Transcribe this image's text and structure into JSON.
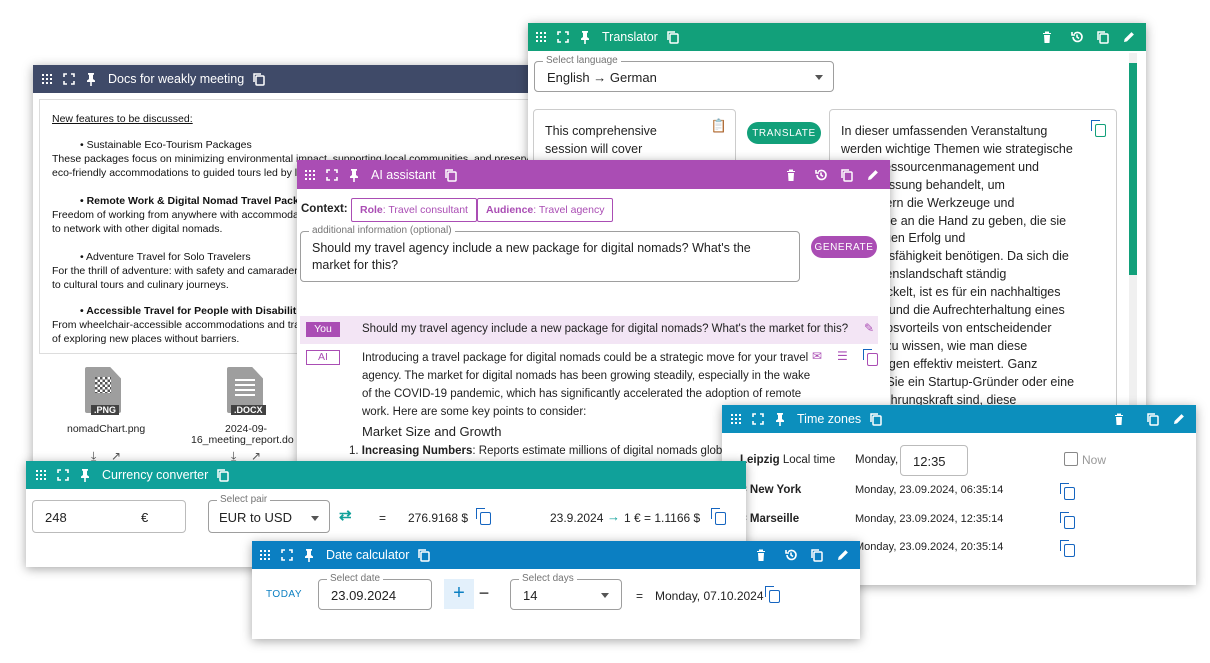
{
  "docs": {
    "title": "Docs for weakly meeting",
    "heading": "New features to be discussed:",
    "features": [
      {
        "title": "• Sustainable Eco-Tourism Packages",
        "desc1": "These packages focus on minimizing environmental impact, supporting local communities, and preserving natu",
        "desc2": "eco-friendly accommodations to guided tours led by loca",
        "bold": false
      },
      {
        "title": "• Remote Work & Digital Nomad Travel Package",
        "desc1": "Freedom of working from anywhere with accommodation",
        "desc2": "to network with other digital nomads.",
        "bold": true
      },
      {
        "title": "• Adventure Travel for Solo Travelers",
        "desc1": "For the thrill of adventure: with safety and camaraderie i",
        "desc2": "to cultural tours and culinary journeys.",
        "bold": false
      },
      {
        "title": "• Accessible Travel for People with Disabilities",
        "desc1": "From wheelchair-accessible accommodations and transp",
        "desc2": "of exploring new places without barriers.",
        "bold": true
      }
    ],
    "files": [
      {
        "badge": ".PNG",
        "name": "nomadChart.png",
        "name2": ""
      },
      {
        "badge": ".DOCX",
        "name": "2024-09-",
        "name2": "16_meeting_report.do"
      }
    ]
  },
  "translator": {
    "title": "Translator",
    "lang_label": "Select language",
    "lang_value": "English → German",
    "source": [
      "This comprehensive",
      "session will cover"
    ],
    "translate_label": "TRANSLATE",
    "target": [
      "In dieser umfassenden Veranstaltung",
      "werden wichtige Themen wie strategische",
      "Ressourcenmanagement und",
      "passung behandelt, um",
      "mern die Werkzeuge und",
      "isse an die Hand zu geben, die sie",
      "itigen Erfolg und",
      "ndsfähigkeit benötigen. Da sich die",
      "menslandschaft ständig",
      "wickelt, ist es für ein nachhaltiges",
      "m und die Aufrechterhaltung eines",
      "erbsvorteils von entscheidender",
      "g zu wissen, wie man diese",
      "ungen effektiv meistert. Ganz",
      "b Sie ein Startup-Gründer oder eine",
      "Führungskraft sind, diese"
    ]
  },
  "ai": {
    "title": "AI assistant",
    "context_label": "Context:",
    "role_key": "Role",
    "role_val": ": Travel consultant",
    "aud_key": "Audience",
    "aud_val": ": Travel agency",
    "add_label": "additional information (optional)",
    "add_value": "Should my travel agency include a new package for digital nomads? What's the market for this?",
    "generate_label": "GENERATE",
    "you_label": "You",
    "you_msg": "Should my travel agency include a new package for digital nomads? What's the market for this?",
    "ai_label": "AI",
    "ai_lines": [
      "Introducing a travel package for digital nomads could be a strategic move for your travel",
      "agency. The market for digital nomads has been growing steadily, especially in the wake",
      "of the COVID-19 pandemic, which has significantly accelerated the adoption of remote",
      "work. Here are some key points to consider:"
    ],
    "section_heading": "Market Size and Growth",
    "item_bold": "Increasing Numbers",
    "item_rest": ": Reports estimate millions of digital nomads globally"
  },
  "timezones": {
    "title": "Time zones",
    "home_city": "Leipzig",
    "home_suffix": "Local time",
    "home_day": "Monday,",
    "home_time": "12:35",
    "now_label": "Now",
    "rows": [
      {
        "city": "= New York",
        "time": "Monday, 23.09.2024, 06:35:14"
      },
      {
        "city": "= Marseille",
        "time": "Monday, 23.09.2024, 12:35:14"
      },
      {
        "city": "",
        "time": "Monday, 23.09.2024, 20:35:14"
      }
    ]
  },
  "currency": {
    "title": "Currency converter",
    "amount": "248",
    "unit": "€",
    "pair_label": "Select pair",
    "pair_value": "EUR to USD",
    "eq": "=",
    "result": "276.9168 $",
    "rate_date": "23.9.2024",
    "rate": "1 € = 1.1166 $"
  },
  "date": {
    "title": "Date calculator",
    "today_label": "TODAY",
    "date_label": "Select date",
    "date_value": "23.09.2024",
    "plus": "+",
    "minus": "−",
    "days_label": "Select days",
    "days_value": "14",
    "eq": "=",
    "result": "Monday, 07.10.2024"
  },
  "colors": {
    "translator": "#12a07a",
    "docs": "#3f4a68",
    "ai": "#aa4db4",
    "timezones": "#0c8fbd",
    "currency": "#10a19a",
    "date": "#0b7fc2"
  }
}
